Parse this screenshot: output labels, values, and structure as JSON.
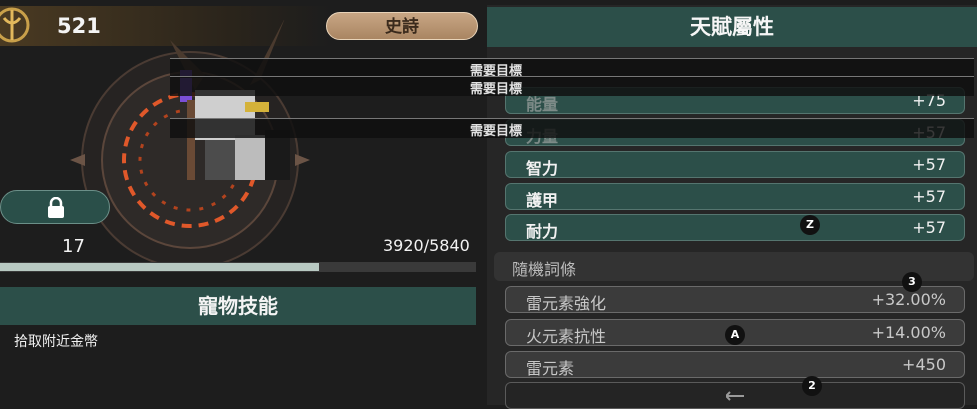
{
  "power": {
    "value": "521"
  },
  "rarity": {
    "label": "史詩"
  },
  "pet": {
    "level": "17",
    "exp_text": "3920/5840",
    "exp_progress": 0.67
  },
  "skill": {
    "header": "寵物技能",
    "description": "拾取附近金幣"
  },
  "talent": {
    "header": "天賦屬性",
    "stats": [
      {
        "name": "能量",
        "value": "+75"
      },
      {
        "name": "力量",
        "value": "+57"
      },
      {
        "name": "智力",
        "value": "+57"
      },
      {
        "name": "護甲",
        "value": "+57"
      },
      {
        "name": "耐力",
        "value": "+57"
      }
    ]
  },
  "random": {
    "header": "隨機詞條",
    "items": [
      {
        "name": "雷元素強化",
        "value": "+32.00%"
      },
      {
        "name": "火元素抗性",
        "value": "+14.00%"
      },
      {
        "name": "雷元素",
        "value": "+450"
      }
    ]
  },
  "target_overlay": {
    "label": "需要目標"
  },
  "markers": [
    "Z",
    "3",
    "A",
    "2"
  ],
  "colors": {
    "teal": "#2c4f49",
    "gold": "#c8a684",
    "glow": "#e0582a"
  }
}
